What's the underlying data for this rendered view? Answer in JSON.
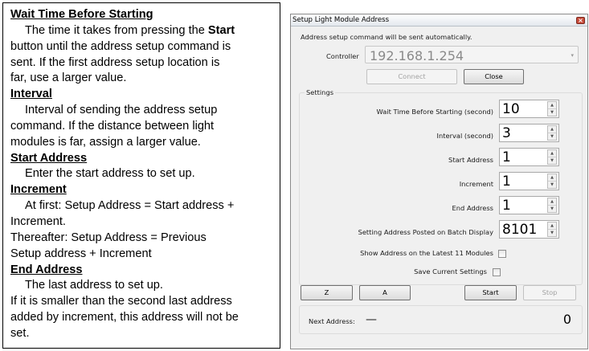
{
  "help": {
    "wait_heading": "Wait Time Before Starting",
    "wait_lines": [
      [
        "The time it takes from pressing the ",
        "Start"
      ],
      "button until the address setup command is",
      "sent. If the first address setup location is",
      "far, use a larger value."
    ],
    "interval_heading": "Interval",
    "interval_lines": [
      "Interval of sending the address setup",
      "command.  If the distance between light",
      "modules is far, assign a larger value."
    ],
    "start_heading": "Start Address",
    "start_lines": [
      "Enter the start address to set up."
    ],
    "increment_heading": "Increment",
    "increment_lines": [
      "At first: Setup Address = Start address +",
      "Increment.",
      "Thereafter: Setup Address = Previous",
      "Setup address + Increment"
    ],
    "end_heading": "End Address",
    "end_lines": [
      "The last address to set up.",
      "If it is smaller than the second last address",
      "added by increment, this address will not be",
      "set."
    ]
  },
  "dialog": {
    "title": "Setup Light Module Address",
    "close_glyph": "×",
    "note": "Address setup command will be sent automatically.",
    "controller_label": "Controller",
    "controller_value": "192.168.1.254",
    "combo_arrow": "▾",
    "connect_label": "Connect",
    "close_label": "Close",
    "settings_label": "Settings",
    "fields": {
      "wait_label": "Wait Time Before Starting (second)",
      "wait_value": "10",
      "interval_label": "Interval (second)",
      "interval_value": "3",
      "start_label": "Start Address",
      "start_value": "1",
      "increment_label": "Increment",
      "increment_value": "1",
      "end_label": "End Address",
      "end_value": "1",
      "batch_label": "Setting Address Posted on Batch Display",
      "batch_value": "8101"
    },
    "spin_up": "▲",
    "spin_down": "▼",
    "show_latest_label": "Show Address on the Latest 11 Modules",
    "save_settings_label": "Save Current Settings",
    "z_label": "Z",
    "a_label": "A",
    "start_label": "Start",
    "stop_label": "Stop",
    "next_address_label": "Next Address:",
    "next_address_value": "—",
    "count_value": "0"
  }
}
